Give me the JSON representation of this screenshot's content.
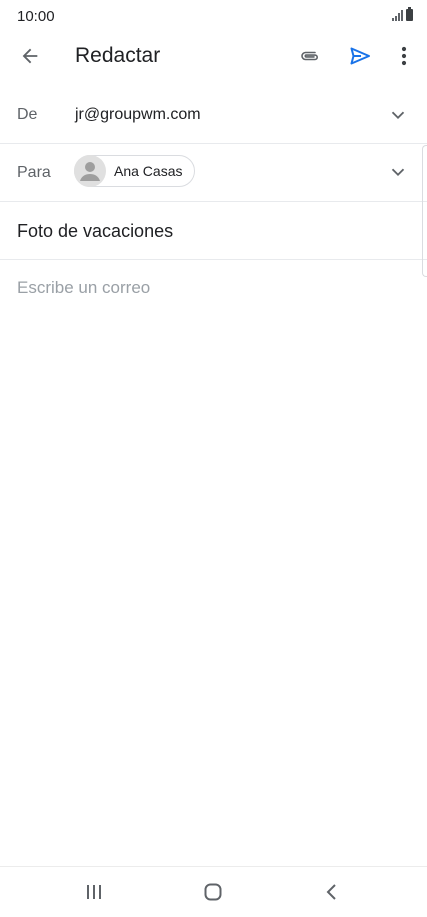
{
  "status": {
    "time": "10:00"
  },
  "toolbar": {
    "title": "Redactar"
  },
  "compose": {
    "from_label": "De",
    "from_value": "jr@groupwm.com",
    "to_label": "Para",
    "to_chip": "Ana Casas",
    "subject": "Foto de vacaciones",
    "body_placeholder": "Escribe un correo"
  },
  "colors": {
    "send_accent": "#1a73e8",
    "text": "#202124",
    "muted": "#5f6368"
  }
}
